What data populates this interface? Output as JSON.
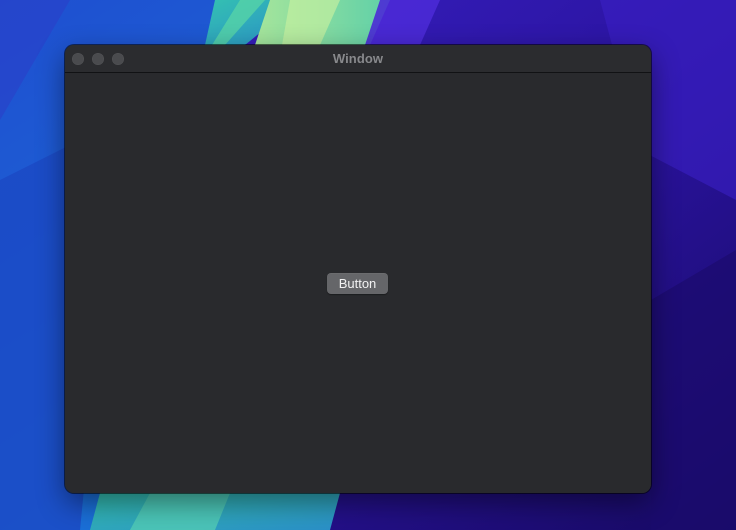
{
  "window": {
    "title": "Window"
  },
  "content": {
    "button_label": "Button"
  },
  "colors": {
    "window_background": "#292a2d",
    "titlebar_background": "#2b2c2f",
    "title_text": "#88898c",
    "traffic_light": "#4a4b4e",
    "button_background": "#656669",
    "button_text": "#f2f2f2"
  }
}
